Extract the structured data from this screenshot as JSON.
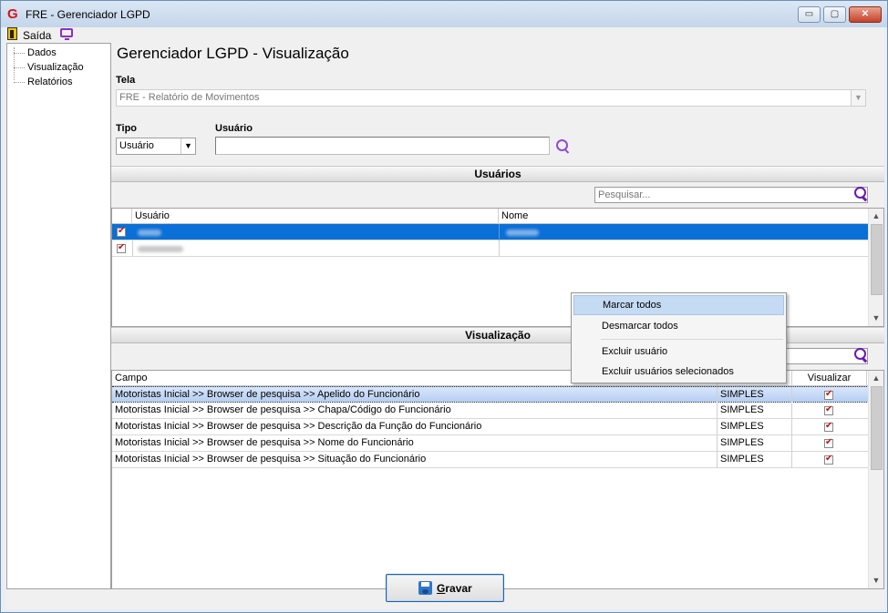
{
  "window": {
    "title": "FRE - Gerenciador LGPD",
    "logo_letter": "G",
    "min_glyph": "▭",
    "max_glyph": "▢",
    "close_glyph": "✕"
  },
  "menu": {
    "exit_label": "Saída",
    "exit_icon": "exit-door-icon",
    "monitor_icon": "monitor-icon"
  },
  "tree": {
    "items": [
      {
        "label": "Dados"
      },
      {
        "label": "Visualização"
      },
      {
        "label": "Relatórios"
      }
    ]
  },
  "main": {
    "heading": "Gerenciador LGPD - Visualização",
    "tela_label": "Tela",
    "tela_value": "FRE - Relatório de Movimentos",
    "tipo_label": "Tipo",
    "tipo_value": "Usuário",
    "usuario_label": "Usuário",
    "usuario_value": ""
  },
  "usuarios": {
    "section_title": "Usuários",
    "search_placeholder": "Pesquisar...",
    "columns": [
      "Usuário",
      "Nome"
    ]
  },
  "context_menu": {
    "items": [
      "Marcar todos",
      "Desmarcar todos",
      "Excluir usuário",
      "Excluir usuários selecionados"
    ]
  },
  "visualizacao": {
    "section_title": "Visualização",
    "columns": [
      "Campo",
      "Visualizar"
    ],
    "rows": [
      {
        "campo": "Motoristas Inicial >> Browser de pesquisa >> Apelido do Funcionário",
        "tipo": "SIMPLES"
      },
      {
        "campo": "Motoristas Inicial >> Browser de pesquisa >> Chapa/Código do Funcionário",
        "tipo": "SIMPLES"
      },
      {
        "campo": "Motoristas Inicial >> Browser de pesquisa >> Descrição da Função do Funcionário",
        "tipo": "SIMPLES"
      },
      {
        "campo": "Motoristas Inicial >> Browser de pesquisa >> Nome do Funcionário",
        "tipo": "SIMPLES"
      },
      {
        "campo": "Motoristas Inicial >> Browser de pesquisa >> Situação do Funcionário",
        "tipo": "SIMPLES"
      }
    ]
  },
  "footer": {
    "save_label_underlined": "G",
    "save_label_rest": "ravar"
  },
  "colors": {
    "selection": "#0a6fd6",
    "accent_purple": "#8f4bd6",
    "check_red": "#c41010"
  }
}
